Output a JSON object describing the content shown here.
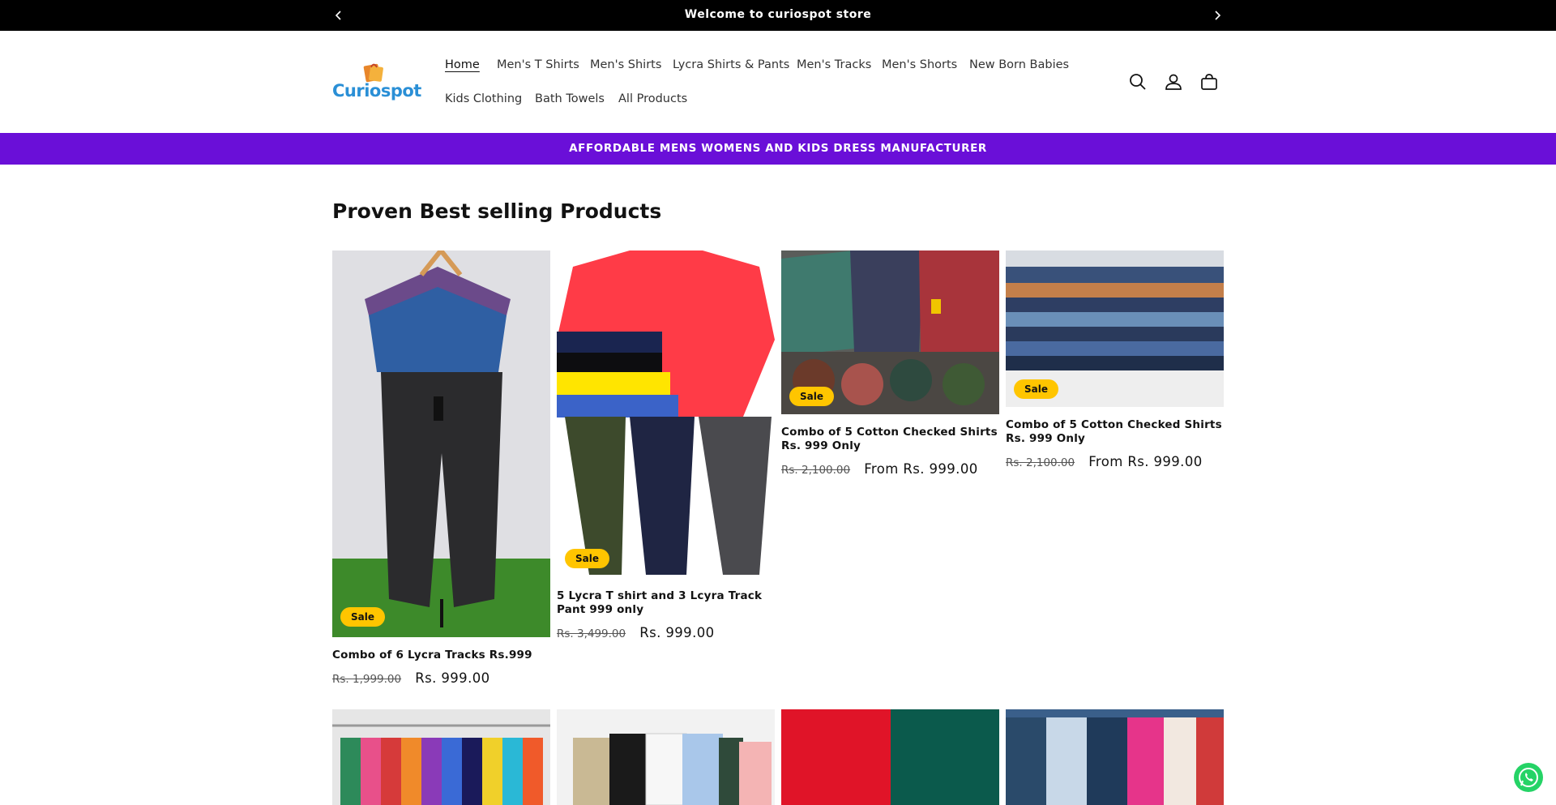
{
  "announcement": {
    "text": "Welcome to curiospot store"
  },
  "header": {
    "logo_text": "Curiospot",
    "nav": [
      {
        "label": "Home"
      },
      {
        "label": "Men's T Shirts"
      },
      {
        "label": "Men's Shirts"
      },
      {
        "label": "Lycra Shirts & Pants"
      },
      {
        "label": "Men's Tracks"
      },
      {
        "label": "Men's Shorts"
      },
      {
        "label": "New Born Babies"
      },
      {
        "label": "Kids Clothing"
      },
      {
        "label": "Bath Towels"
      },
      {
        "label": "All Products"
      }
    ],
    "icons": [
      "search-icon",
      "account-icon",
      "cart-icon"
    ]
  },
  "banner": {
    "text": "AFFORDABLE MENS WOMENS AND KIDS DRESS MANUFACTURER"
  },
  "section": {
    "title": "Proven Best selling Products"
  },
  "products": [
    {
      "badge": "Sale",
      "title": "Combo of 6 Lycra Tracks Rs.999",
      "old_price": "Rs. 1,999.00",
      "price": "Rs. 999.00"
    },
    {
      "badge": "Sale",
      "title": "5 Lycra T shirt and 3 Lcyra Track Pant 999 only",
      "old_price": "Rs. 3,499.00",
      "price": "Rs. 999.00"
    },
    {
      "badge": "Sale",
      "title": "Combo of 5 Cotton Checked Shirts Rs. 999 Only",
      "old_price": "Rs. 2,100.00",
      "price": "From Rs. 999.00"
    },
    {
      "badge": "Sale",
      "title": "Combo of 5 Cotton Checked Shirts Rs. 999 Only",
      "old_price": "Rs. 2,100.00",
      "price": "From Rs. 999.00"
    }
  ],
  "colors": {
    "announcement_bg": "#000000",
    "banner_bg": "#6a0fd8",
    "sale_badge": "#ffc500",
    "logo": "#2a8fd6",
    "whatsapp": "#25d366"
  }
}
